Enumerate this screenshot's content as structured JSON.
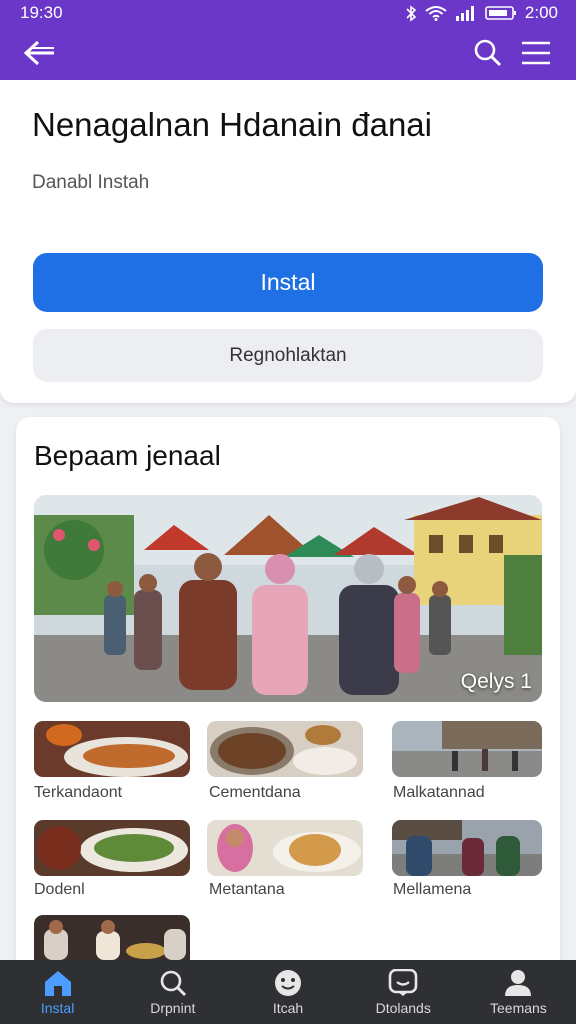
{
  "status": {
    "time": "19:30",
    "clock": "2:00"
  },
  "app": {
    "title": "Nenagalnan Hdanain đanai",
    "subtitle": "Danabl  Instah",
    "install_label": "Instal",
    "secondary_label": "Regnohlaktan"
  },
  "section": {
    "title": "Bepaam jenaal",
    "hero_badge": "Qelys 1"
  },
  "thumbnails": [
    {
      "label": "Terkandaont"
    },
    {
      "label": "Cementdana"
    },
    {
      "label": "Malkatannad"
    },
    {
      "label": "Dodenl"
    },
    {
      "label": "Metantana"
    },
    {
      "label": "Mellamena"
    },
    {
      "label": ""
    }
  ],
  "nav": [
    {
      "label": "Instal",
      "icon": "home-icon"
    },
    {
      "label": "Drpnint",
      "icon": "search-icon"
    },
    {
      "label": "Itcah",
      "icon": "face-icon"
    },
    {
      "label": "Dtolands",
      "icon": "chat-icon"
    },
    {
      "label": "Teemans",
      "icon": "person-icon"
    }
  ],
  "colors": {
    "brand": "#6a37c9",
    "accent": "#1f6fe5",
    "nav_active": "#4c9dff"
  }
}
